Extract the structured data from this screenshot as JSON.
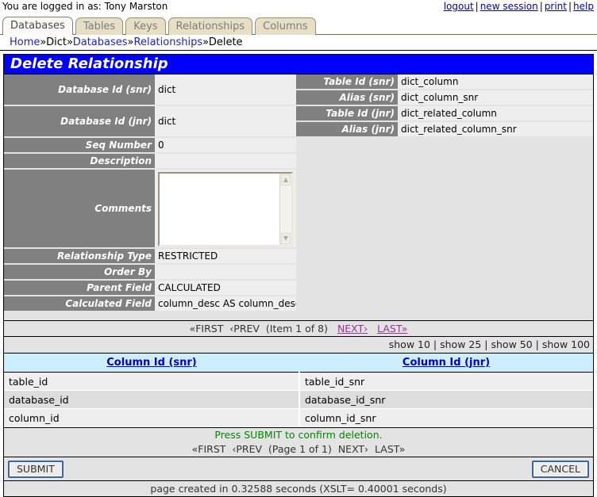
{
  "topbar": {
    "logged_in_text": "You are logged in as: Tony Marston",
    "links": [
      {
        "label": "logout"
      },
      {
        "label": "new session"
      },
      {
        "label": "print"
      },
      {
        "label": "help"
      }
    ],
    "separator": "|"
  },
  "tabs": [
    {
      "label": "Databases",
      "active": true
    },
    {
      "label": "Tables",
      "active": false
    },
    {
      "label": "Keys",
      "active": false
    },
    {
      "label": "Relationships",
      "active": false
    },
    {
      "label": "Columns",
      "active": false
    }
  ],
  "breadcrumb": {
    "separator": "»",
    "items": [
      {
        "label": "Home",
        "link": true
      },
      {
        "label": "Dict",
        "link": false
      },
      {
        "label": "Databases",
        "link": true
      },
      {
        "label": "Relationships",
        "link": true
      },
      {
        "label": "Delete",
        "link": false
      }
    ]
  },
  "page": {
    "title": "Delete Relationship"
  },
  "detail": {
    "left_fields": [
      {
        "label": "Database Id (snr)",
        "value": "dict",
        "type": "tall"
      },
      {
        "label": "Database Id (jnr)",
        "value": "dict",
        "type": "tall"
      },
      {
        "label": "Seq Number",
        "value": "0",
        "type": "normal"
      },
      {
        "label": "Description",
        "value": "",
        "type": "normal"
      },
      {
        "label": "Comments",
        "value": "",
        "type": "textarea"
      },
      {
        "label": "Relationship Type",
        "value": "RESTRICTED",
        "type": "normal"
      },
      {
        "label": "Order By",
        "value": "",
        "type": "normal"
      },
      {
        "label": "Parent Field",
        "value": "CALCULATED",
        "type": "normal"
      },
      {
        "label": "Calculated Field",
        "value": "column_desc AS column_desc_snr",
        "type": "normal"
      }
    ],
    "right_fields": [
      {
        "label": "Table Id (snr)",
        "value": "dict_column"
      },
      {
        "label": "Alias (snr)",
        "value": "dict_column_snr"
      },
      {
        "label": "Table Id (jnr)",
        "value": "dict_related_column"
      },
      {
        "label": "Alias (jnr)",
        "value": "dict_related_column_snr"
      }
    ],
    "comments_value": ""
  },
  "item_pagination": {
    "first": "«FIRST",
    "prev": "‹PREV",
    "position": "(Item 1 of 8)",
    "next": "NEXT›",
    "last": "LAST»"
  },
  "show_options": {
    "items": [
      "show 10",
      "show 25",
      "show 50",
      "show 100"
    ],
    "separator": "|"
  },
  "child_table": {
    "columns": [
      "Column Id (snr)",
      "Column Id (jnr)"
    ],
    "rows": [
      [
        "table_id",
        "table_id_snr"
      ],
      [
        "database_id",
        "database_id_snr"
      ],
      [
        "column_id",
        "column_id_snr"
      ]
    ]
  },
  "message": "Press SUBMIT to confirm deletion.",
  "page_pagination": {
    "first": "«FIRST",
    "prev": "‹PREV",
    "position": "(Page 1 of 1)",
    "next": "NEXT›",
    "last": "LAST»"
  },
  "buttons": {
    "submit": "SUBMIT",
    "cancel": "CANCEL"
  },
  "footer": {
    "timing": "page created in 0.32588 seconds (XSLT= 0.40001 seconds)"
  },
  "colors": {
    "title_bar": "#0000ff",
    "label_bg": "#808080",
    "value_bg": "#eeeeee",
    "panel_bg": "#e3e3e3",
    "header_bg": "#cceeff",
    "link_blue": "#0000cc",
    "link_visited": "#993399",
    "message_green": "#008800",
    "tab_bg": "#e6dfc6"
  }
}
